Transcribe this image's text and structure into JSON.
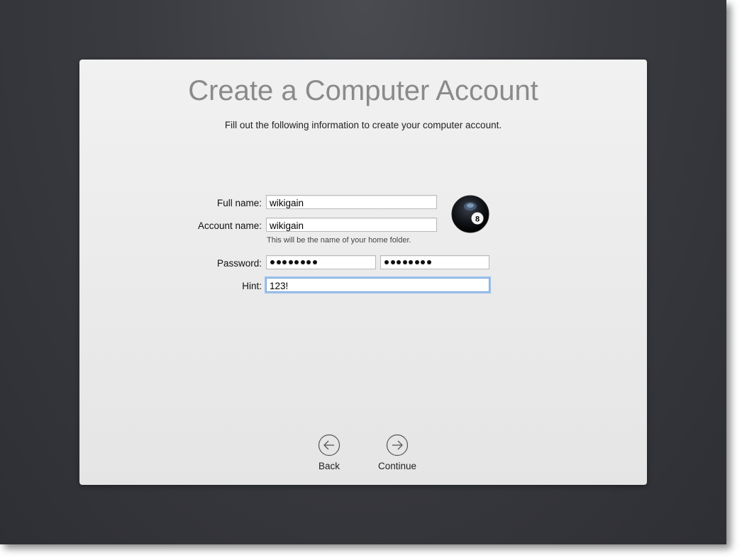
{
  "dialog": {
    "title": "Create a Computer Account",
    "subtitle": "Fill out the following information to create your computer account."
  },
  "form": {
    "full_name_label": "Full name:",
    "full_name_value": "wikigain",
    "account_name_label": "Account name:",
    "account_name_value": "wikigain",
    "account_name_helper": "This will be the name of your home folder.",
    "password_label": "Password:",
    "password_dot_count": 8,
    "verify_dot_count": 8,
    "hint_label": "Hint:",
    "hint_value": "123!"
  },
  "avatar": {
    "icon": "eight-ball-icon",
    "number": "8"
  },
  "navigation": {
    "back_label": "Back",
    "continue_label": "Continue"
  }
}
